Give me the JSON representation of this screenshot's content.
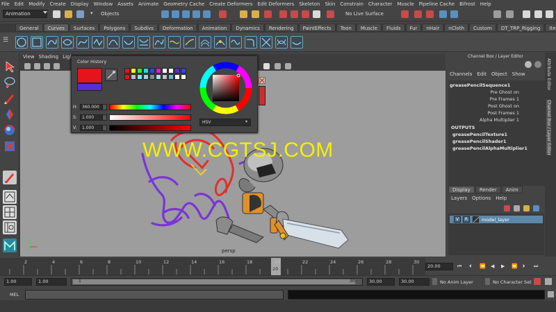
{
  "menubar": [
    "File",
    "Edit",
    "Modify",
    "Create",
    "Display",
    "Window",
    "Assets",
    "Animate",
    "Geometry Cache",
    "Create Deformers",
    "Edit Deformers",
    "Skeleton",
    "Skin",
    "Constrain",
    "Character",
    "Muscle",
    "Pipeline Cache",
    "Bifrost",
    "Help"
  ],
  "status_line": {
    "mode_dropdown": "Animation",
    "objects_label": "Objects",
    "live_surface": "No Live Surface"
  },
  "shelf_tabs": [
    "General",
    "Curves",
    "Surfaces",
    "Polygons",
    "Subdivs",
    "Deformation",
    "Animation",
    "Dynamics",
    "Rendering",
    "PaintEffects",
    "Toon",
    "Muscle",
    "Fluids",
    "Fur",
    "nHair",
    "nCloth",
    "Custom",
    "DT_TRP_Rigging",
    "Item"
  ],
  "shelf_active_tab": "Curves",
  "viewport_menu": [
    "View",
    "Shading",
    "Ligh"
  ],
  "viewport_label": "persp",
  "color_dialog": {
    "history_label": "Color History",
    "h_label": "H:",
    "h_value": "360.000",
    "s_label": "S:",
    "s_value": "1.000",
    "v_label": "V:",
    "v_value": "1.000",
    "mode_dropdown": "HSV",
    "current_color": "#e5131c",
    "history_swatches": [
      "#e5131c",
      "#f7f020",
      "#3fe23c",
      "#16e0e0",
      "#2b49e8",
      "#e816e0",
      "#ffffff",
      "#ffffff",
      "#5a2bd6",
      "#2b49e8",
      "#e5131c",
      "#bfbfbf",
      "#7fe8e8",
      "#9ad3e0",
      "#8a8a8a",
      "#a8e0e8",
      "#c0c0c0",
      "#6fb0d8",
      "#ffffff",
      "#ffffff"
    ]
  },
  "watermark": "WWW.CGTSJ.COM",
  "channel_box": {
    "title": "Channel Box / Layer Editor",
    "menu": [
      "Channels",
      "Edit",
      "Object",
      "Show"
    ],
    "node": "greasePencilSequence1",
    "attributes": [
      "Pre Ghost on",
      "Pre Frames 1",
      "Post Ghost on",
      "Post Frames 1",
      "Alpha Multiplier 1"
    ],
    "outputs_label": "OUTPUTS",
    "outputs": [
      "greasePencilTexture1",
      "greasePencilShader1",
      "greasePencilAlphaMultiplier1"
    ]
  },
  "side_tabs": [
    "Attribute Editor",
    "Channel Box / Layer Editor"
  ],
  "layer_editor": {
    "tabs": [
      "Display",
      "Render",
      "Anim"
    ],
    "active_tab": "Display",
    "menu": [
      "Layers",
      "Options",
      "Help"
    ],
    "layer": {
      "v": "V",
      "r": "R",
      "name": "model_layer"
    }
  },
  "timeline": {
    "ticks": [
      "2",
      "4",
      "6",
      "8",
      "10",
      "12",
      "14",
      "16",
      "18",
      "20",
      "22",
      "24",
      "26",
      "28",
      "30"
    ],
    "current_frame": "20",
    "current_field": "20.00"
  },
  "range": {
    "start": "1.00",
    "start_inner": "1.00",
    "slider_start": "1",
    "slider_end": "30",
    "end_inner": "30.00",
    "end": "30.00",
    "anim_layer": "No Anim Layer",
    "character_set": "No Character Set"
  },
  "command_line": {
    "label": "MEL"
  }
}
